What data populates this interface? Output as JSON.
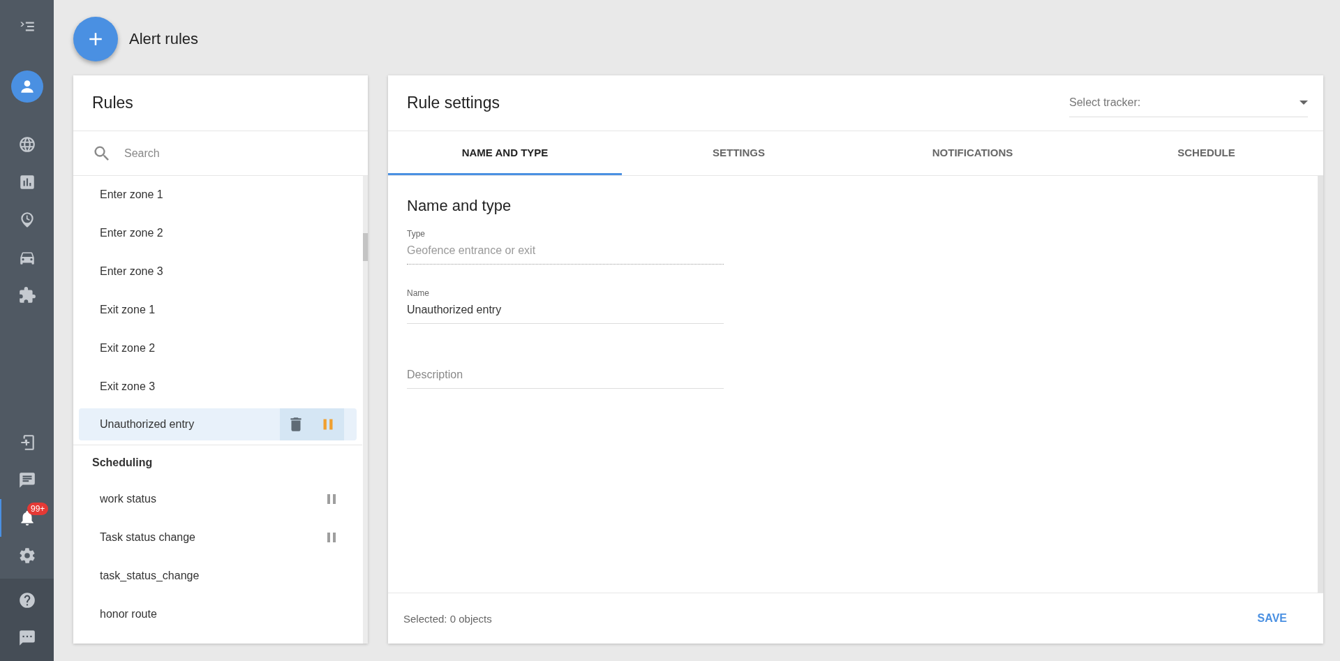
{
  "sidebar": {
    "items": [
      {
        "selected": false
      },
      {
        "selected": false
      },
      {
        "selected": false
      },
      {
        "selected": false
      },
      {
        "selected": false
      },
      {
        "selected": false
      },
      {
        "selected": false
      },
      {
        "selected": false
      },
      {
        "selected": false
      },
      {
        "selected": true,
        "badge": "99+"
      },
      {
        "selected": false
      },
      {
        "selected": false
      },
      {
        "selected": false
      }
    ]
  },
  "page": {
    "title": "Alert rules"
  },
  "rules_panel": {
    "title": "Rules",
    "search": {
      "placeholder": "Search"
    },
    "groups": [
      {
        "items": [
          {
            "name": "Enter zone 1",
            "selected": false,
            "paused": false
          },
          {
            "name": "Enter zone 2",
            "selected": false,
            "paused": false
          },
          {
            "name": "Enter zone 3",
            "selected": false,
            "paused": false
          },
          {
            "name": "Exit zone 1",
            "selected": false,
            "paused": false
          },
          {
            "name": "Exit zone 2",
            "selected": false,
            "paused": false
          },
          {
            "name": "Exit zone 3",
            "selected": false,
            "paused": false
          },
          {
            "name": "Unauthorized entry",
            "selected": true,
            "paused": false
          }
        ]
      },
      {
        "heading": "Scheduling",
        "items": [
          {
            "name": "work status",
            "selected": false,
            "paused": true
          },
          {
            "name": "Task status change",
            "selected": false,
            "paused": true
          },
          {
            "name": "task_status_change",
            "selected": false,
            "paused": false
          },
          {
            "name": "honor route",
            "selected": false,
            "paused": false
          }
        ]
      }
    ]
  },
  "settings_panel": {
    "title": "Rule settings",
    "tracker_select": {
      "placeholder": "Select tracker:"
    },
    "tabs": [
      {
        "label": "NAME AND TYPE",
        "selected": true
      },
      {
        "label": "SETTINGS",
        "selected": false
      },
      {
        "label": "NOTIFICATIONS",
        "selected": false
      },
      {
        "label": "SCHEDULE",
        "selected": false
      }
    ],
    "section_title": "Name and type",
    "fields": [
      {
        "label": "Type",
        "value": "Geofence entrance or exit",
        "disabled": true
      },
      {
        "label": "Name",
        "value": "Unauthorized entry",
        "disabled": false
      },
      {
        "placeholder": "Description",
        "disabled": false
      }
    ],
    "footer": {
      "status": "Selected: 0 objects",
      "save_button": "SAVE"
    }
  }
}
